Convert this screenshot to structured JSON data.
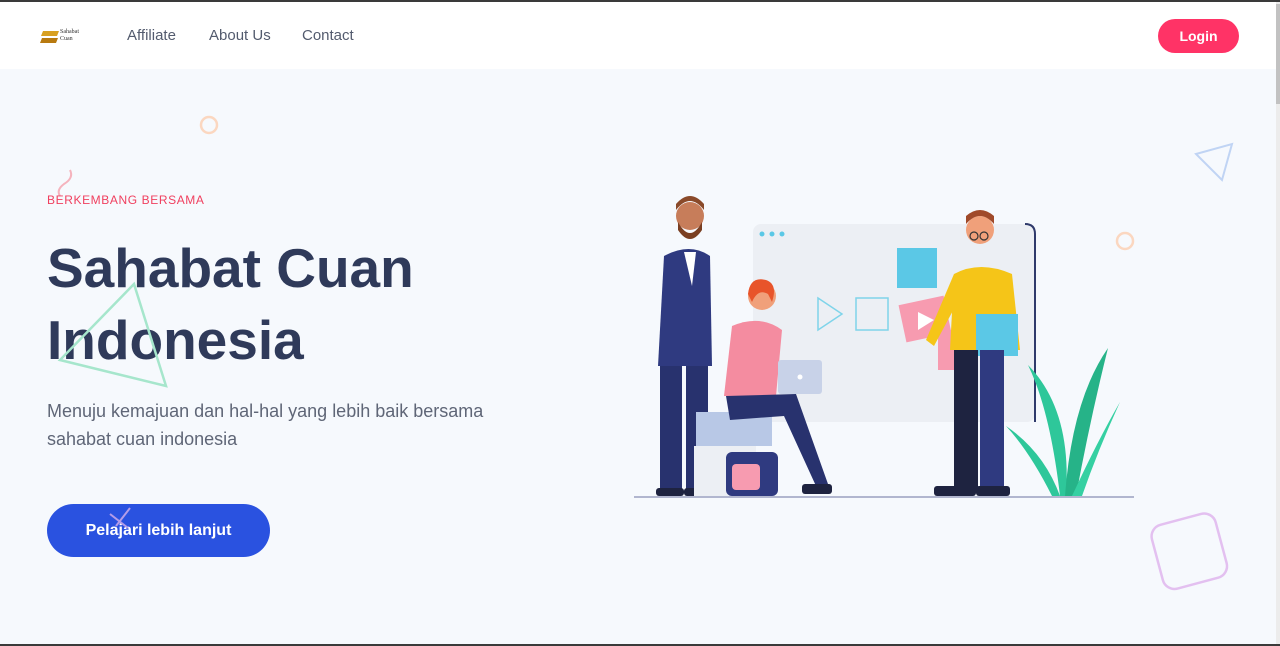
{
  "header": {
    "logo_text": "Sahabat\nCuan",
    "nav": [
      "Affiliate",
      "About Us",
      "Contact"
    ],
    "login_label": "Login"
  },
  "hero": {
    "eyebrow": "BERKEMBANG BERSAMA",
    "title_line1": "Sahabat Cuan",
    "title_line2": "Indonesia",
    "subtitle_line1": "Menuju kemajuan dan hal-hal yang lebih baik bersama",
    "subtitle_line2": "sahabat cuan indonesia",
    "cta_label": "Pelajari lebih lanjut"
  },
  "colors": {
    "accent_pink": "#ff3366",
    "cta_blue": "#2a52e0",
    "title_navy": "#2f3a5a",
    "page_bg": "#f6f9fd"
  },
  "icons": [
    "logo-icon",
    "hero-illustration"
  ]
}
